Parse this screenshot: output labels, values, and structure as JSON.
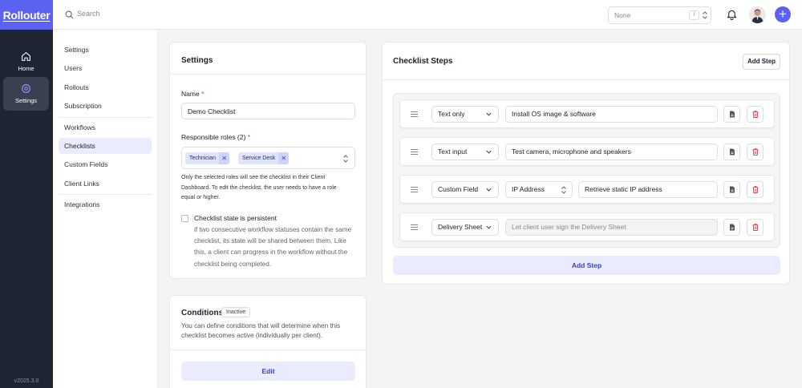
{
  "app": {
    "logo": "Rollouter",
    "version": "v2025.3.0"
  },
  "rail": {
    "items": [
      {
        "label": "Home",
        "icon": "home-icon"
      },
      {
        "label": "Settings",
        "icon": "settings-icon",
        "active": true
      }
    ]
  },
  "topbar": {
    "search_placeholder": "Search",
    "select_value": "None",
    "shortcut_key": "/"
  },
  "subnav": {
    "items": [
      "Settings",
      "Users",
      "Rollouts",
      "Subscription",
      "Workflows",
      "Checklists",
      "Custom Fields",
      "Client Links",
      "Integrations"
    ],
    "active": "Checklists"
  },
  "settings_card": {
    "title": "Settings",
    "name_label": "Name",
    "name_value": "Demo Checklist",
    "roles_label": "Responsible roles (2)",
    "roles": [
      "Technician",
      "Service Desk"
    ],
    "roles_hint": "Only the selected roles will see the checklist in their Client Dashboard. To edit the checklist, the user needs to have a role equal or higher.",
    "persistent_label": "Checklist state is persistent",
    "persistent_desc": "if two consecutive workflow statuses contain the same checklist, its state will be shared between them. Like this, a client can progress in the workflow without the checklist being completed."
  },
  "conditions_card": {
    "title": "Conditions",
    "badge": "Inactive",
    "desc": "You can define conditions that will determine when this checklist becomes active (individually per client).",
    "edit_label": "Edit"
  },
  "steps_card": {
    "title": "Checklist Steps",
    "add_top": "Add Step",
    "add_bottom": "Add Step",
    "steps": [
      {
        "type": "Text only",
        "text": "Install OS image & software"
      },
      {
        "type": "Text input",
        "text": "Test camera, microphone and speakers"
      },
      {
        "type": "Custom Field",
        "field": "IP Address",
        "text": "Retrieve static IP address"
      },
      {
        "type": "Delivery Sheet",
        "text": "Let client user sign the Delivery Sheet"
      }
    ]
  },
  "colors": {
    "accent": "#5b61f0",
    "rail": "#1f2433",
    "danger": "#e04545"
  }
}
